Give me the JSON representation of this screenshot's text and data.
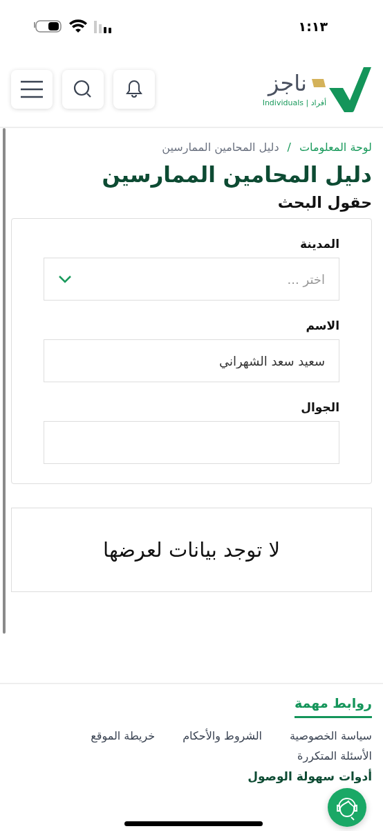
{
  "status_bar": {
    "time": "١:١٣"
  },
  "header": {
    "logo_name": "ناجز",
    "logo_tagline": "أفراد | Individuals"
  },
  "breadcrumb": [
    {
      "label": "لوحة المعلومات",
      "current": false
    },
    {
      "label": "دليل المحامين الممارسين",
      "current": true
    }
  ],
  "breadcrumb_separator": "/",
  "page_title": "دليل المحامين الممارسين",
  "section_title": "حقول البحث",
  "form": {
    "fields": [
      {
        "kind": "select",
        "label": "المدينة",
        "placeholder": "اختر ..."
      },
      {
        "kind": "text",
        "label": "الاسم",
        "value": "سعيد سعد الشهراني"
      },
      {
        "kind": "text",
        "label": "الجوال"
      }
    ]
  },
  "results": {
    "empty_message": "لا توجد بيانات لعرضها"
  },
  "footer": {
    "heading": "روابط مهمة",
    "links": [
      "سياسة الخصوصية",
      "الشروط والأحكام",
      "خريطة الموقع",
      "الأسئلة المتكررة"
    ],
    "next_heading": "أدوات سهولة الوصول"
  }
}
